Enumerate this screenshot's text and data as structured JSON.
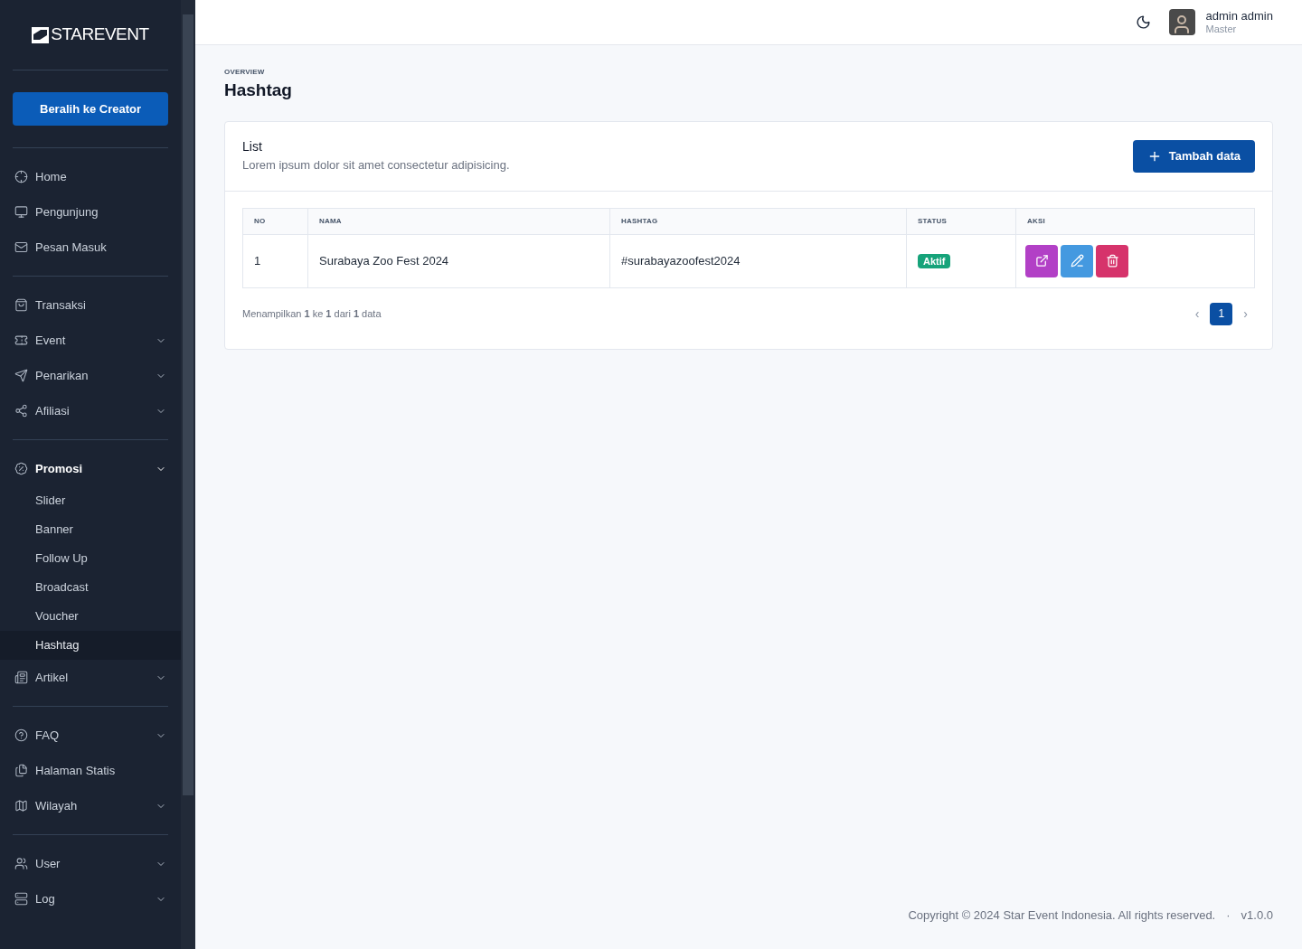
{
  "sidebar": {
    "logo": "STAREVENT",
    "switch_button": "Beralih ke Creator",
    "groups": [
      [
        {
          "label": "Home",
          "expandable": false,
          "selected": false
        },
        {
          "label": "Pengunjung",
          "expandable": false,
          "selected": false
        },
        {
          "label": "Pesan Masuk",
          "expandable": false,
          "selected": false
        }
      ],
      [
        {
          "label": "Transaksi",
          "expandable": false,
          "selected": false
        },
        {
          "label": "Event",
          "expandable": true,
          "expanded": false,
          "selected": false
        },
        {
          "label": "Penarikan",
          "expandable": true,
          "expanded": false,
          "selected": false
        },
        {
          "label": "Afiliasi",
          "expandable": true,
          "expanded": false,
          "selected": false
        }
      ],
      [
        {
          "label": "Promosi",
          "expandable": true,
          "expanded": true,
          "selected": false,
          "children": [
            {
              "label": "Slider",
              "selected": false
            },
            {
              "label": "Banner",
              "selected": false
            },
            {
              "label": "Follow Up",
              "selected": false
            },
            {
              "label": "Broadcast",
              "selected": false
            },
            {
              "label": "Voucher",
              "selected": false
            },
            {
              "label": "Hashtag",
              "selected": true
            }
          ]
        },
        {
          "label": "Artikel",
          "expandable": true,
          "expanded": false,
          "selected": false
        }
      ],
      [
        {
          "label": "FAQ",
          "expandable": true,
          "expanded": false,
          "selected": false
        },
        {
          "label": "Halaman Statis",
          "expandable": false,
          "selected": false
        },
        {
          "label": "Wilayah",
          "expandable": true,
          "expanded": false,
          "selected": false
        }
      ],
      [
        {
          "label": "User",
          "expandable": true,
          "expanded": false,
          "selected": false
        },
        {
          "label": "Log",
          "expandable": true,
          "expanded": false,
          "selected": false
        }
      ]
    ]
  },
  "header": {
    "user_name": "admin admin",
    "user_role": "Master"
  },
  "page": {
    "overline": "OVERVIEW",
    "title": "Hashtag"
  },
  "card": {
    "title": "List",
    "subtitle": "Lorem ipsum dolor sit amet consectetur adipisicing.",
    "add_button": "Tambah data"
  },
  "table": {
    "columns": [
      "NO",
      "NAMA",
      "HASHTAG",
      "STATUS",
      "AKSI"
    ],
    "rows": [
      {
        "no": "1",
        "nama": "Surabaya Zoo Fest 2024",
        "hashtag": "#surabayazoofest2024",
        "status": "Aktif",
        "color": "#16a37a"
      }
    ]
  },
  "pagination": {
    "summary": "Menampilkan **1** ke **1** dari **1** data",
    "prev": "‹",
    "next": "›",
    "pages": [
      {
        "label": "1",
        "selected": true
      }
    ]
  },
  "footer": {
    "copyright": "Copyright © 2024 Star Event Indonesia. All rights reserved.",
    "separator": "·",
    "version": "v1.0.0"
  }
}
